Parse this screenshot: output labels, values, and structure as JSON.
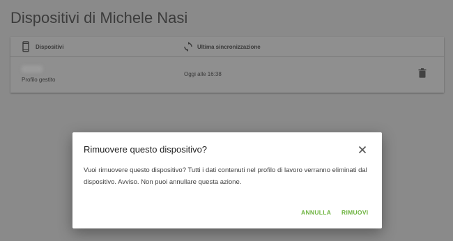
{
  "page": {
    "title": "Dispositivi di Michele Nasi"
  },
  "table": {
    "columns": [
      {
        "label": "Dispositivi",
        "icon": "phone-icon"
      },
      {
        "label": "Ultima sincronizzazione",
        "icon": "sync-icon"
      }
    ],
    "rows": [
      {
        "subtitle": "Profilo gestito",
        "last_sync": "Oggi alle 16:38",
        "action_icon": "trash-icon"
      }
    ]
  },
  "dialog": {
    "title": "Rimuovere questo dispositivo?",
    "body": "Vuoi rimuovere questo dispositivo? Tutti i dati contenuti nel profilo di lavoro verranno eliminati dal dispositivo. Avviso. Non puoi annullare questa azione.",
    "cancel_label": "ANNULLA",
    "confirm_label": "RIMUOVI",
    "close_icon": "close-icon"
  },
  "colors": {
    "accent": "#6db33f",
    "overlay": "#8a8a8a",
    "dialog_bg": "#ffffff"
  }
}
